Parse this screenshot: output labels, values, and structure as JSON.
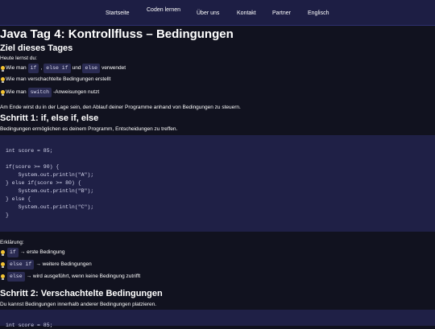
{
  "nav": {
    "items": [
      "Startseite",
      "Coden lernen",
      "Über uns",
      "Kontakt",
      "Partner",
      "Englisch"
    ]
  },
  "page": {
    "title": "Java Tag 4: Kontrollfluss – Bedingungen",
    "goals_heading": "Ziel dieses Tages",
    "goals_intro": "Heute lernst du:",
    "goal1": {
      "pre": "Wie man",
      "code1": "if",
      "sep": ",",
      "code2": "else if",
      "mid": "und",
      "code3": "else",
      "post": "verwendet"
    },
    "goal2": {
      "text": "Wie man verschachtelte Bedingungen erstellt"
    },
    "goal3": {
      "pre": "Wie man",
      "code": "switch",
      "post": "-Anweisungen nutzt"
    },
    "goals_outro": "Am Ende wirst du in der Lage sein, den Ablauf deiner Programme anhand von Bedingungen zu steuern.",
    "step1_heading": "Schritt 1: if, else if, else",
    "step1_intro": "Bedingungen ermöglichen es deinem Programm, Entscheidungen zu treffen.",
    "code1_lines": [
      "int score = 85;",
      "",
      "if(score >= 90) {",
      "    System.out.println(\"A\");",
      "} else if(score >= 80) {",
      "    System.out.println(\"B\");",
      "} else {",
      "    System.out.println(\"C\");",
      "}"
    ],
    "explain_label": "Erklärung:",
    "explain1": {
      "code": "if",
      "text": "→ erste Bedingung"
    },
    "explain2": {
      "code": "else if",
      "text": "→ weitere Bedingungen"
    },
    "explain3": {
      "code": "else",
      "text": "→ wird ausgeführt, wenn keine Bedingung zutrifft"
    },
    "step2_heading": "Schritt 2: Verschachtelte Bedingungen",
    "step2_intro": "Du kannst Bedingungen innerhalb anderer Bedingungen platzieren.",
    "code2_partial": "int score = 85;"
  },
  "icons": {
    "bullet": "lightbulb-icon"
  },
  "colors": {
    "background": "#11121f",
    "nav": "#1d1e44",
    "codeblock": "#1f2046",
    "bulb": "#f5c431"
  }
}
